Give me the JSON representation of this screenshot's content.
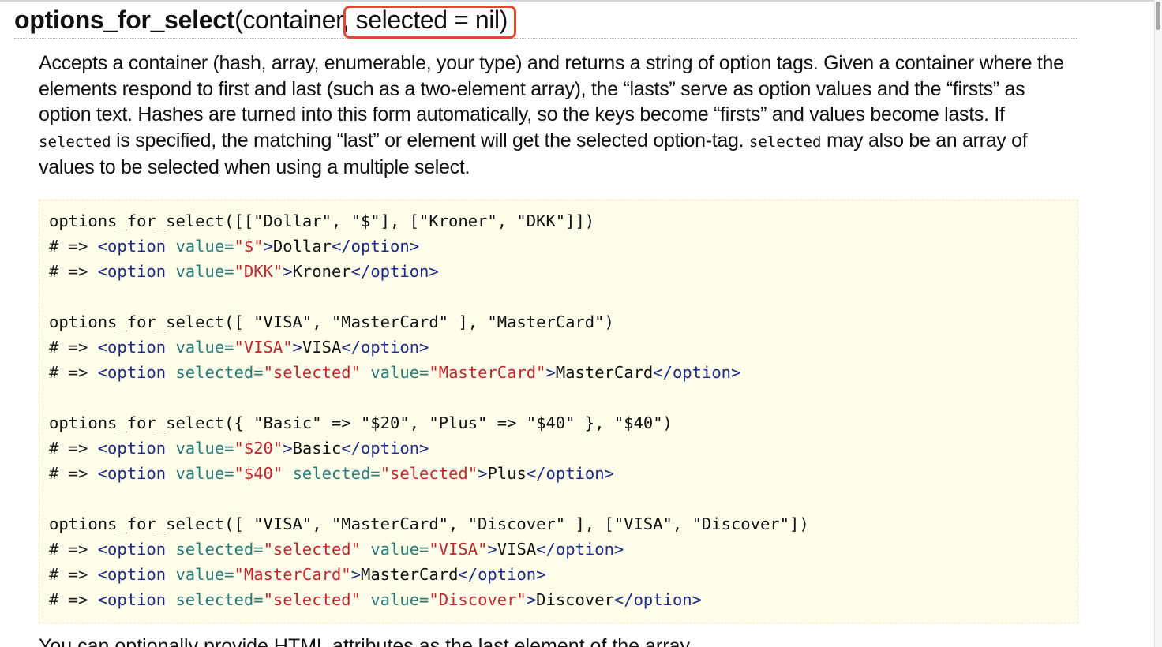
{
  "heading": {
    "method_name": "options_for_select",
    "args_prefix": "(container",
    "args_highlighted": ", selected = nil)"
  },
  "description": {
    "part1": "Accepts a container (hash, array, enumerable, your type) and returns a string of option tags. Given a container where the elements respond to first and last (such as a two-element array), the “lasts” serve as option values and the “firsts” as option text. Hashes are turned into this form automatically, so the keys become “firsts” and values become lasts. If ",
    "code1": "selected",
    "part2": " is specified, the matching “last” or element will get the selected option-tag. ",
    "code2": "selected",
    "part3": " may also be an array of values to be selected when using a multiple select."
  },
  "code_lines": [
    [
      {
        "t": "plain",
        "v": "options_for_select([[\"Dollar\", \"$\"], [\"Kroner\", \"DKK\"]])"
      }
    ],
    [
      {
        "t": "comment",
        "v": "# => "
      },
      {
        "t": "tag",
        "v": "<option "
      },
      {
        "t": "attr",
        "v": "value="
      },
      {
        "t": "str",
        "v": "\"$\""
      },
      {
        "t": "tag",
        "v": ">"
      },
      {
        "t": "text",
        "v": "Dollar"
      },
      {
        "t": "tag",
        "v": "</option>"
      }
    ],
    [
      {
        "t": "comment",
        "v": "# => "
      },
      {
        "t": "tag",
        "v": "<option "
      },
      {
        "t": "attr",
        "v": "value="
      },
      {
        "t": "str",
        "v": "\"DKK\""
      },
      {
        "t": "tag",
        "v": ">"
      },
      {
        "t": "text",
        "v": "Kroner"
      },
      {
        "t": "tag",
        "v": "</option>"
      }
    ],
    [],
    [
      {
        "t": "plain",
        "v": "options_for_select([ \"VISA\", \"MasterCard\" ], \"MasterCard\")"
      }
    ],
    [
      {
        "t": "comment",
        "v": "# => "
      },
      {
        "t": "tag",
        "v": "<option "
      },
      {
        "t": "attr",
        "v": "value="
      },
      {
        "t": "str",
        "v": "\"VISA\""
      },
      {
        "t": "tag",
        "v": ">"
      },
      {
        "t": "text",
        "v": "VISA"
      },
      {
        "t": "tag",
        "v": "</option>"
      }
    ],
    [
      {
        "t": "comment",
        "v": "# => "
      },
      {
        "t": "tag",
        "v": "<option "
      },
      {
        "t": "attr",
        "v": "selected="
      },
      {
        "t": "str",
        "v": "\"selected\""
      },
      {
        "t": "plain",
        "v": " "
      },
      {
        "t": "attr",
        "v": "value="
      },
      {
        "t": "str",
        "v": "\"MasterCard\""
      },
      {
        "t": "tag",
        "v": ">"
      },
      {
        "t": "text",
        "v": "MasterCard"
      },
      {
        "t": "tag",
        "v": "</option>"
      }
    ],
    [],
    [
      {
        "t": "plain",
        "v": "options_for_select({ \"Basic\" => \"$20\", \"Plus\" => \"$40\" }, \"$40\")"
      }
    ],
    [
      {
        "t": "comment",
        "v": "# => "
      },
      {
        "t": "tag",
        "v": "<option "
      },
      {
        "t": "attr",
        "v": "value="
      },
      {
        "t": "str",
        "v": "\"$20\""
      },
      {
        "t": "tag",
        "v": ">"
      },
      {
        "t": "text",
        "v": "Basic"
      },
      {
        "t": "tag",
        "v": "</option>"
      }
    ],
    [
      {
        "t": "comment",
        "v": "# => "
      },
      {
        "t": "tag",
        "v": "<option "
      },
      {
        "t": "attr",
        "v": "value="
      },
      {
        "t": "str",
        "v": "\"$40\""
      },
      {
        "t": "plain",
        "v": " "
      },
      {
        "t": "attr",
        "v": "selected="
      },
      {
        "t": "str",
        "v": "\"selected\""
      },
      {
        "t": "tag",
        "v": ">"
      },
      {
        "t": "text",
        "v": "Plus"
      },
      {
        "t": "tag",
        "v": "</option>"
      }
    ],
    [],
    [
      {
        "t": "plain",
        "v": "options_for_select([ \"VISA\", \"MasterCard\", \"Discover\" ], [\"VISA\", \"Discover\"])"
      }
    ],
    [
      {
        "t": "comment",
        "v": "# => "
      },
      {
        "t": "tag",
        "v": "<option "
      },
      {
        "t": "attr",
        "v": "selected="
      },
      {
        "t": "str",
        "v": "\"selected\""
      },
      {
        "t": "plain",
        "v": " "
      },
      {
        "t": "attr",
        "v": "value="
      },
      {
        "t": "str",
        "v": "\"VISA\""
      },
      {
        "t": "tag",
        "v": ">"
      },
      {
        "t": "text",
        "v": "VISA"
      },
      {
        "t": "tag",
        "v": "</option>"
      }
    ],
    [
      {
        "t": "comment",
        "v": "# => "
      },
      {
        "t": "tag",
        "v": "<option "
      },
      {
        "t": "attr",
        "v": "value="
      },
      {
        "t": "str",
        "v": "\"MasterCard\""
      },
      {
        "t": "tag",
        "v": ">"
      },
      {
        "t": "text",
        "v": "MasterCard"
      },
      {
        "t": "tag",
        "v": "</option>"
      }
    ],
    [
      {
        "t": "comment",
        "v": "# => "
      },
      {
        "t": "tag",
        "v": "<option "
      },
      {
        "t": "attr",
        "v": "selected="
      },
      {
        "t": "str",
        "v": "\"selected\""
      },
      {
        "t": "plain",
        "v": " "
      },
      {
        "t": "attr",
        "v": "value="
      },
      {
        "t": "str",
        "v": "\"Discover\""
      },
      {
        "t": "tag",
        "v": ">"
      },
      {
        "t": "text",
        "v": "Discover"
      },
      {
        "t": "tag",
        "v": "</option>"
      }
    ]
  ],
  "trailing_text": "You can optionally provide HTML attributes as the last element of the array.",
  "colors": {
    "highlight_border": "#e8452e",
    "code_background": "#fefde9",
    "tag": "#1a2a86",
    "attribute": "#2a7a7a",
    "string": "#c0272d"
  }
}
